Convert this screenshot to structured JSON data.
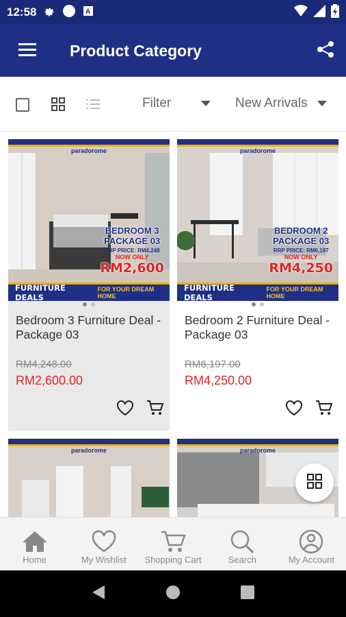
{
  "status_bar": {
    "time": "12:58",
    "left_icons": [
      "gear-icon",
      "circle-icon",
      "a-box-icon"
    ],
    "right_icons": [
      "wifi-icon",
      "signal-icon",
      "battery-icon"
    ]
  },
  "app_bar": {
    "title": "Product Category",
    "menu_icon": "hamburger-icon",
    "share_icon": "share-icon"
  },
  "toolbar": {
    "filter_label": "Filter",
    "sort_label": "New Arrivals",
    "icons": [
      "checkbox-icon",
      "grid-view-icon",
      "list-view-icon"
    ]
  },
  "products": [
    {
      "title": "Bedroom 3 Furniture Deal - Package 03",
      "old_price": "RM4,248.00",
      "new_price": "RM2,600.00",
      "image": {
        "brand": "paradorome",
        "package_line1": "BEDROOM 3",
        "package_line2": "PACKAGE 03",
        "rrp": "RRP PRICE: RM4,248",
        "now_only": "NOW ONLY",
        "promo_price": "RM2,600",
        "banner_main": "FURNITURE DEALS",
        "banner_sub": "FOR YOUR DREAM HOME"
      }
    },
    {
      "title": "Bedroom 2 Furniture Deal - Package 03",
      "old_price": "RM6,197.00",
      "new_price": "RM4,250.00",
      "image": {
        "brand": "paradorome",
        "package_line1": "BEDROOM 2",
        "package_line2": "PACKAGE 03",
        "rrp": "RRP PRICE: RM6,197",
        "now_only": "NOW ONLY",
        "promo_price": "RM4,250",
        "banner_main": "FURNITURE DEALS",
        "banner_sub": "FOR YOUR DREAM HOME"
      }
    },
    {
      "image": {
        "brand": "paradorome"
      }
    },
    {
      "image": {
        "brand": "paradorome"
      }
    }
  ],
  "bottom_nav": [
    {
      "label": "Home",
      "icon": "home-icon"
    },
    {
      "label": "My Wishlist",
      "icon": "heart-icon"
    },
    {
      "label": "Shopping Cart",
      "icon": "cart-icon"
    },
    {
      "label": "Search",
      "icon": "search-icon"
    },
    {
      "label": "My Account",
      "icon": "account-icon"
    }
  ],
  "colors": {
    "primary": "#1f2f86",
    "price_red": "#e02424",
    "accent_yellow": "#f0b000"
  }
}
